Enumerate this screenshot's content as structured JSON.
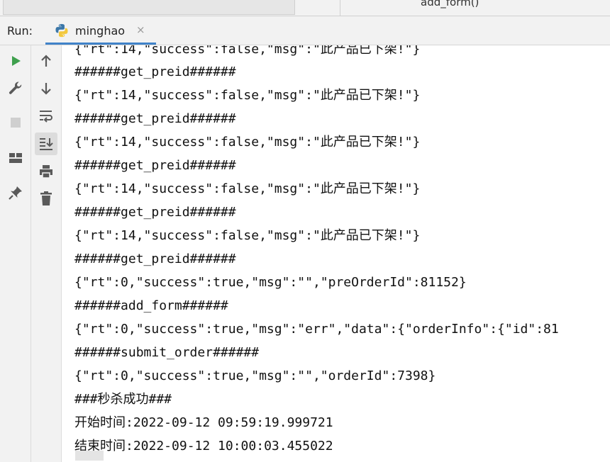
{
  "topbar": {
    "tab_label": "add_form()"
  },
  "runbar": {
    "label": "Run:",
    "tab_name": "minghao",
    "close_glyph": "×"
  },
  "left_toolbar": {
    "icons": [
      "run-icon",
      "wrench-icon",
      "stop-icon",
      "layout-icon",
      "pin-icon"
    ]
  },
  "mid_toolbar": {
    "icons": [
      "arrow-up-icon",
      "arrow-down-icon",
      "soft-wrap-icon",
      "scroll-to-end-icon",
      "print-icon",
      "trash-icon"
    ]
  },
  "console": {
    "lines": [
      "{\"rt\":14,\"success\":false,\"msg\":\"此产品已下架!\"}",
      "######get_preid######",
      "{\"rt\":14,\"success\":false,\"msg\":\"此产品已下架!\"}",
      "######get_preid######",
      "{\"rt\":14,\"success\":false,\"msg\":\"此产品已下架!\"}",
      "######get_preid######",
      "{\"rt\":14,\"success\":false,\"msg\":\"此产品已下架!\"}",
      "######get_preid######",
      "{\"rt\":14,\"success\":false,\"msg\":\"此产品已下架!\"}",
      "######get_preid######",
      "{\"rt\":0,\"success\":true,\"msg\":\"\",\"preOrderId\":81152}",
      "######add_form######",
      "{\"rt\":0,\"success\":true,\"msg\":\"err\",\"data\":{\"orderInfo\":{\"id\":81",
      "######submit_order######",
      "{\"rt\":0,\"success\":true,\"msg\":\"\",\"orderId\":7398}",
      "###秒杀成功###",
      "开始时间:2022-09-12 09:59:19.999721",
      "结束时间:2022-09-12 10:00:03.455022"
    ]
  },
  "colors": {
    "run_green": "#3ea04d",
    "icon_gray": "#5a5a5a",
    "tab_underline": "#4083c9"
  }
}
